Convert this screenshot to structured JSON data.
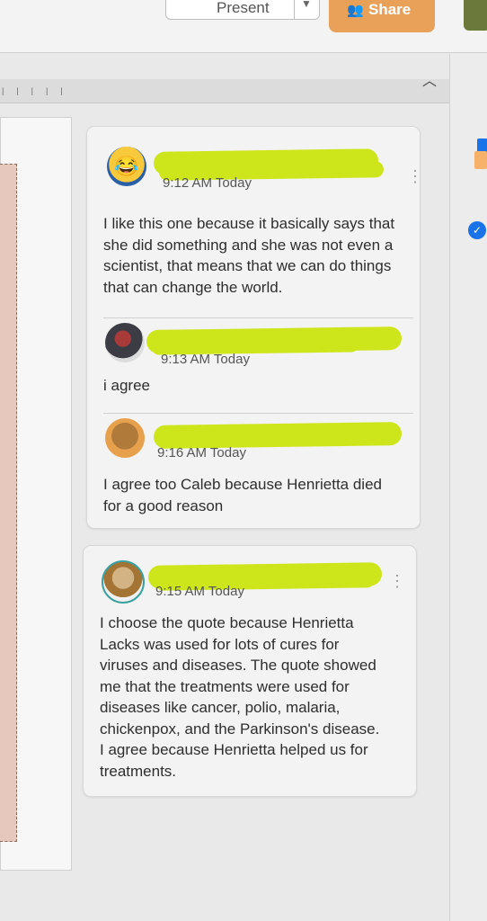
{
  "toolbar": {
    "present_label": "Present",
    "share_label": "Share",
    "share_icon": "people-icon"
  },
  "comments": [
    {
      "time": "9:12 AM Today",
      "text": "I like this one because it basically says that she did something and she was not even a scientist, that means that we can do things that can change the world."
    },
    {
      "time": "9:13 AM Today",
      "text": "i agree"
    },
    {
      "time": "9:16 AM Today",
      "text": "I agree too Caleb because Henrietta died for a good reason"
    },
    {
      "time": "9:15 AM Today",
      "text": "I choose the quote because Henrietta Lacks was used for lots of cures for viruses and diseases. The quote showed me that the treatments were used for diseases like cancer, polio, malaria, chickenpox, and the Parkinson's disease. I agree because Henrietta helped us for treatments."
    }
  ],
  "colors": {
    "redaction": "#cde61c",
    "share_button": "#e9a15a",
    "accent": "#1a73e8"
  }
}
